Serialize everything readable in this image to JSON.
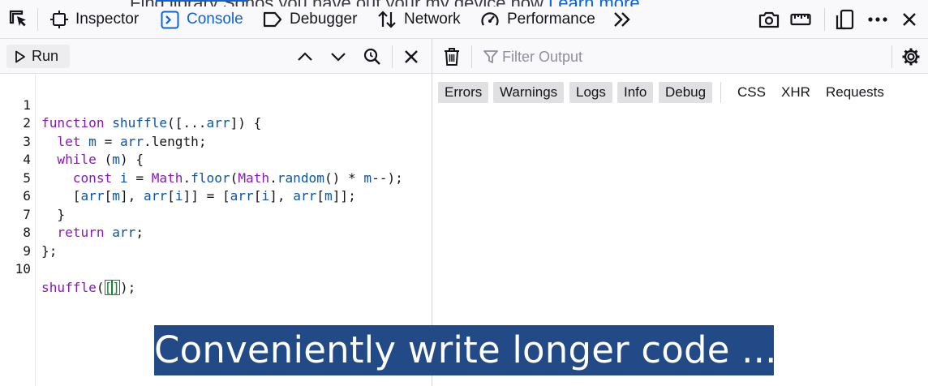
{
  "window_peek": {
    "text": "Find library Sonos you have out your my device.now",
    "link": "Learn more"
  },
  "toolbar": {
    "tabs": [
      {
        "label": "Inspector",
        "icon": "inspector-icon",
        "selected": false
      },
      {
        "label": "Console",
        "icon": "console-icon",
        "selected": true
      },
      {
        "label": "Debugger",
        "icon": "debugger-icon",
        "selected": false
      },
      {
        "label": "Network",
        "icon": "network-icon",
        "selected": false
      },
      {
        "label": "Performance",
        "icon": "performance-icon",
        "selected": false
      }
    ],
    "accent_color": "#0a63d8"
  },
  "editor": {
    "run_label": "Run",
    "lines": [
      {
        "num": "1"
      },
      {
        "num": "2"
      },
      {
        "num": "3"
      },
      {
        "num": "4"
      },
      {
        "num": "5"
      },
      {
        "num": "6"
      },
      {
        "num": "7"
      },
      {
        "num": "8"
      },
      {
        "num": "9"
      },
      {
        "num": "10"
      }
    ],
    "code": {
      "l1_kw": "function",
      "l1_fn": "shuffle",
      "l1_rest_a": "([...",
      "l1_var": "arr",
      "l1_rest_b": "]) {",
      "l2_kw": "let",
      "l2_var": "m",
      "l2_op": " = ",
      "l2_var2": "arr",
      "l2_rest": ".length;",
      "l3_kw": "while",
      "l3_rest_a": " (",
      "l3_var": "m",
      "l3_rest_b": ") {",
      "l4_kw": "const",
      "l4_var": "i",
      "l4_op": " = ",
      "l4_obj": "Math",
      "l4_dot": ".",
      "l4_fn": "floor",
      "l4_paren": "(",
      "l4_obj2": "Math",
      "l4_dot2": ".",
      "l4_fn2": "random",
      "l4_rest_a": "() * ",
      "l4_var2": "m",
      "l4_rest_b": "--);",
      "l5_a": "[",
      "l5_v1": "arr",
      "l5_b": "[",
      "l5_v2": "m",
      "l5_c": "], ",
      "l5_v3": "arr",
      "l5_d": "[",
      "l5_v4": "i",
      "l5_e": "]] = [",
      "l5_v5": "arr",
      "l5_f": "[",
      "l5_v6": "i",
      "l5_g": "], ",
      "l5_v7": "arr",
      "l5_h": "[",
      "l5_v8": "m",
      "l5_i": "]];",
      "l6": "}",
      "l7_kw": "return",
      "l7_var": "arr",
      "l7_rest": ";",
      "l8": "};",
      "l10_fn": "shuffle",
      "l10_a": "(",
      "l10_b1": "[",
      "l10_b2": "]",
      "l10_c": ");"
    }
  },
  "console": {
    "filter_placeholder": "Filter Output",
    "chips_active": [
      "Errors",
      "Warnings",
      "Logs",
      "Info",
      "Debug"
    ],
    "chips_inactive": [
      "CSS",
      "XHR",
      "Requests"
    ]
  },
  "caption": "Conveniently write longer code ..."
}
